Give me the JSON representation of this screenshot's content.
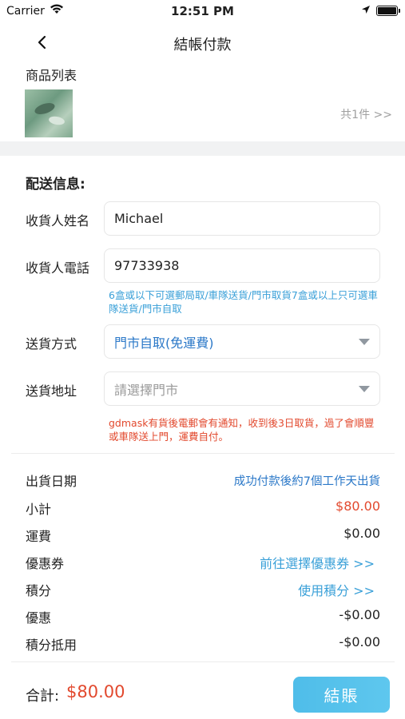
{
  "status_bar": {
    "carrier": "Carrier",
    "time": "12:51 PM"
  },
  "nav": {
    "title": "結帳付款"
  },
  "products": {
    "label": "商品列表",
    "count_link": "共1件 >>"
  },
  "delivery": {
    "title": "配送信息:",
    "name_label": "收貨人姓名",
    "name_value": "Michael",
    "phone_label": "收貨人電話",
    "phone_value": "97733938",
    "phone_hint": "6盒或以下可選郵局取/車隊送貨/門市取貨7盒或以上只可選車隊送貨/門市自取",
    "method_label": "送貨方式",
    "method_value": "門市自取(免運費)",
    "address_label": "送貨地址",
    "address_placeholder": "請選擇門市",
    "address_hint": "gdmask有貨後電郵會有通知，收到後3日取貨，過了會順豐或車隊送上門，運費自付。"
  },
  "summary": {
    "ship_date_label": "出貨日期",
    "ship_date_value": "成功付款後約7個工作天出貨",
    "subtotal_label": "小計",
    "subtotal_value": "$80.00",
    "shipping_label": "運費",
    "shipping_value": "$0.00",
    "coupon_label": "優惠券",
    "coupon_link": "前往選擇優惠券 >>",
    "points_label": "積分",
    "points_link": "使用積分 >>",
    "discount_label": "優惠",
    "discount_value": "-$0.00",
    "points_offset_label": "積分抵用",
    "points_offset_value": "-$0.00"
  },
  "footer": {
    "total_label": "合計:",
    "total_value": "$80.00",
    "checkout_label": "結賬"
  },
  "colors": {
    "accent_blue": "#3aa0d8",
    "price_red": "#e2492e",
    "button_blue": "#4fbde9"
  },
  "icons": {
    "back": "chevron-left-icon",
    "wifi": "wifi-icon",
    "location": "location-arrow-icon",
    "battery": "battery-icon",
    "dropdown": "caret-down-icon"
  }
}
